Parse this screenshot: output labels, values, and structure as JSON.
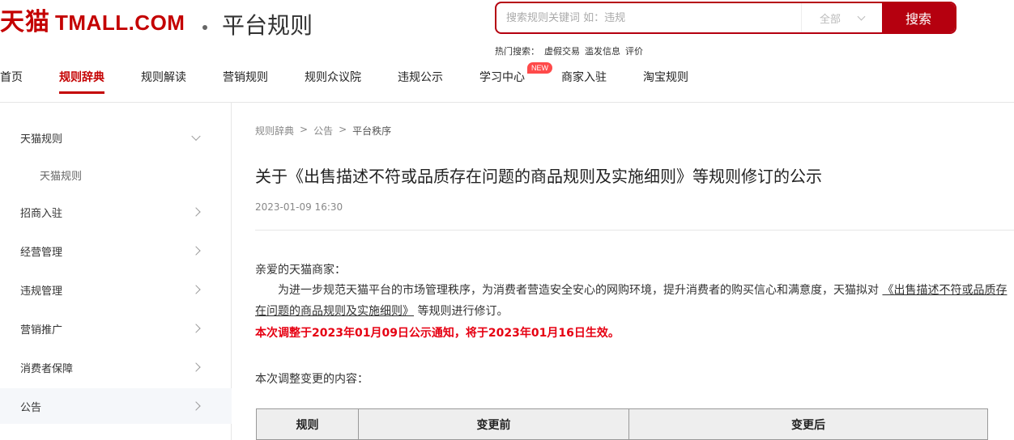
{
  "header": {
    "logo_cn": "天猫",
    "logo_en": "TMALL.COM",
    "site_title": "平台规则",
    "search": {
      "placeholder": "搜索规则关键词 如：违规",
      "scope": "全部",
      "button": "搜索"
    },
    "hot": {
      "label": "热门搜索：",
      "items": [
        "虚假交易",
        "滥发信息",
        "评价"
      ]
    }
  },
  "nav": {
    "items": [
      {
        "label": "首页"
      },
      {
        "label": "规则辞典"
      },
      {
        "label": "规则解读"
      },
      {
        "label": "营销规则"
      },
      {
        "label": "规则众议院"
      },
      {
        "label": "违规公示"
      },
      {
        "label": "学习中心",
        "badge": "NEW"
      },
      {
        "label": "商家入驻"
      },
      {
        "label": "淘宝规则"
      }
    ],
    "active_index": 1
  },
  "sidebar": {
    "items": [
      {
        "label": "天猫规则",
        "arrow": "down"
      },
      {
        "label": "天猫规则",
        "sub": true
      },
      {
        "label": "招商入驻",
        "arrow": "right"
      },
      {
        "label": "经营管理",
        "arrow": "right"
      },
      {
        "label": "违规管理",
        "arrow": "right"
      },
      {
        "label": "营销推广",
        "arrow": "right"
      },
      {
        "label": "消费者保障",
        "arrow": "right"
      },
      {
        "label": "公告",
        "arrow": "right",
        "active": true
      }
    ]
  },
  "breadcrumb": {
    "items": [
      "规则辞典",
      "公告",
      "平台秩序"
    ],
    "separator": ">"
  },
  "article": {
    "title": "关于《出售描述不符或品质存在问题的商品规则及实施细则》等规则修订的公示",
    "date": "2023-01-09 16:30",
    "greeting": "亲爱的天猫商家：",
    "para_before": "为进一步规范天猫平台的市场管理秩序，为消费者营造安全安心的网购环境，提升消费者的购买信心和满意度，天猫拟对 ",
    "para_link": "《出售描述不符或品质存在问题的商品规则及实施细则》",
    "para_after": " 等规则进行修订。",
    "notice": "本次调整于2023年01月09日公示通知，将于2023年01月16日生效。",
    "changes_label": "本次调整变更的内容：",
    "table_headers": [
      "规则",
      "变更前",
      "变更后"
    ]
  },
  "colors": {
    "brand": "#c40000",
    "search_border": "#b5000f",
    "notice": "#e60012",
    "badge": "#ff4a4a"
  }
}
